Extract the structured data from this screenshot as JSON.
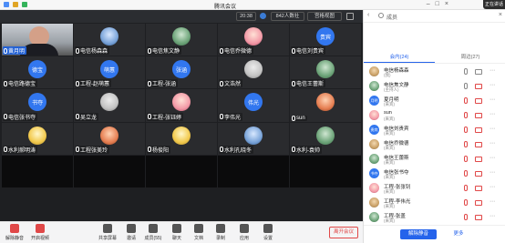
{
  "window": {
    "title": "腾讯会议",
    "corner_badge": "正在讲话"
  },
  "topbar": {
    "clock": "20:38",
    "participant_count": "842人数社",
    "view_label": "宫格视图"
  },
  "panel": {
    "title": "成员",
    "tabs": [
      {
        "label": "会内(24)",
        "active": true
      },
      {
        "label": "周边(27)",
        "active": false
      }
    ],
    "members": [
      {
        "name": "电信杨森森",
        "role": "(我)",
        "avatar": "img1",
        "mic_muted": false,
        "cam_off": false
      },
      {
        "name": "电信焦文静",
        "role": "(主持人)",
        "avatar": "img2",
        "mic_muted": false,
        "cam_off": true
      },
      {
        "name": "夏月明",
        "role": "(来宾)",
        "avatar_text": "月明",
        "avatar": "blue",
        "mic_muted": true,
        "cam_off": true
      },
      {
        "name": "sun",
        "role": "(来宾)",
        "avatar": "img3",
        "mic_muted": true,
        "cam_off": true
      },
      {
        "name": "电信刘贵宾",
        "role": "(来宾)",
        "avatar_text": "贵宾",
        "avatar": "blue",
        "mic_muted": true,
        "cam_off": true
      },
      {
        "name": "电信乔微德",
        "role": "(来宾)",
        "avatar": "img1",
        "mic_muted": true,
        "cam_off": true
      },
      {
        "name": "电信王蕾斯",
        "role": "(来宾)",
        "avatar": "img2",
        "mic_muted": true,
        "cam_off": true
      },
      {
        "name": "电信张书夺",
        "role": "(来宾)",
        "avatar_text": "书夺",
        "avatar": "blue",
        "mic_muted": true,
        "cam_off": true
      },
      {
        "name": "工程-张张钊",
        "role": "(来宾)",
        "avatar": "img3",
        "mic_muted": true,
        "cam_off": true
      },
      {
        "name": "工程-李伟光",
        "role": "(来宾)",
        "avatar": "img1",
        "mic_muted": true,
        "cam_off": true
      },
      {
        "name": "工程-张盖",
        "role": "(来宾)",
        "avatar": "img2",
        "mic_muted": true,
        "cam_off": true
      }
    ],
    "mute_all_label": "解除静音",
    "more_label": "更多"
  },
  "tiles": [
    {
      "name": "黄月明",
      "type": "cam",
      "highlight": true
    },
    {
      "name": "电信杨森森",
      "avatar": "img d"
    },
    {
      "name": "电信焦文静",
      "avatar": "img b"
    },
    {
      "name": "电信乔微德",
      "avatar": "img c"
    },
    {
      "name": "电信刘贵宾",
      "avatar_text": "贵宾"
    },
    {
      "name": "电信路德宝",
      "avatar_text": "德宝"
    },
    {
      "name": "工程-赵萌蕙",
      "avatar_text": "萌蕙"
    },
    {
      "name": "工程-张涵",
      "avatar_text": "张涵"
    },
    {
      "name": "文浩然",
      "avatar": "img f"
    },
    {
      "name": "电信王蕾斯",
      "avatar": "img b"
    },
    {
      "name": "电信张书夺",
      "avatar_text": "书夺"
    },
    {
      "name": "吴立龙",
      "avatar": "img f"
    },
    {
      "name": "工程-张钰婷",
      "avatar": "img c"
    },
    {
      "name": "李伟光",
      "avatar_text": "伟光"
    },
    {
      "name": "sun",
      "avatar": "img g"
    },
    {
      "name": "水利郝明涛",
      "avatar": "img e"
    },
    {
      "name": "工程张美玲",
      "avatar": "img g"
    },
    {
      "name": "杨俊阳",
      "avatar": "img e"
    },
    {
      "name": "水利孔晓冬",
      "avatar": "img d"
    },
    {
      "name": "水利-袁帅",
      "avatar": "img b"
    },
    {
      "name": "",
      "dark": true
    },
    {
      "name": "",
      "dark": true
    },
    {
      "name": "",
      "dark": true
    },
    {
      "name": "",
      "dark": true
    },
    {
      "name": "",
      "dark": true
    }
  ],
  "bottom": {
    "tools": [
      {
        "label": "解除静音",
        "icon": "mic-icon",
        "red": true
      },
      {
        "label": "开启视频",
        "icon": "camera-icon",
        "red": true
      },
      {
        "label": "共享屏幕",
        "icon": "share-icon"
      },
      {
        "label": "邀请",
        "icon": "invite-icon"
      },
      {
        "label": "成员(55)",
        "icon": "members-icon"
      },
      {
        "label": "聊天",
        "icon": "chat-icon"
      },
      {
        "label": "文档",
        "icon": "doc-icon"
      },
      {
        "label": "录制",
        "icon": "record-icon"
      },
      {
        "label": "应用",
        "icon": "apps-icon"
      },
      {
        "label": "设置",
        "icon": "settings-icon"
      }
    ],
    "leave_label": "离开会议"
  }
}
